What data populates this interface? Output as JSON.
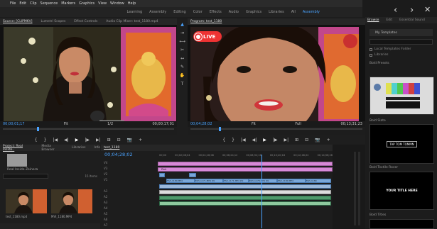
{
  "menu": [
    "File",
    "Edit",
    "Clip",
    "Sequence",
    "Markers",
    "Graphics",
    "View",
    "Window",
    "Help"
  ],
  "window_controls": [
    "—",
    "□",
    "✕"
  ],
  "workspaces": [
    "Learning",
    "Assembly",
    "Editing",
    "Color",
    "Effects",
    "Audio",
    "Graphics",
    "Libraries",
    "All",
    "Assembly"
  ],
  "workspace_active_index": 9,
  "source_monitor": {
    "tabs": [
      "Source: [CLIPMKV]",
      "Lumetri Scopes",
      "Effect Controls",
      "Audio Clip Mixer: test_1180.mp4"
    ],
    "timecode_left": "00;00;01;17",
    "fit": "Fit",
    "ratio": "1/2",
    "timecode_right": "00;00;17;01"
  },
  "program_monitor": {
    "tabs": [
      "Program: test_1180"
    ],
    "timecode_left": "00;04;28;02",
    "fit": "Fit",
    "ratio": "Full",
    "timecode_right": "00;13;31;23",
    "live_badge": "LIVE"
  },
  "transport": [
    "{",
    "}",
    "|◀",
    "◀|",
    "▶",
    "|▶",
    "▶|",
    "⊞",
    "⊟",
    "📷",
    "+"
  ],
  "right_panel": {
    "tabs": [
      "Browse",
      "Edit",
      "Essential Sound"
    ],
    "my_templates": "My Templates",
    "checkbox_1": "Local Templates Folder",
    "checkbox_2": "Libraries",
    "section_1": "Bold Presets",
    "section_2": "Bold Slate",
    "slate_text": "TAP TOM TOMMN",
    "section_3": "Bold Textile Rover",
    "title_text": "YOUR TITLE HERE",
    "section_4": "Bold Titles"
  },
  "project": {
    "tabs": [
      "Project: Real Inside..",
      "Media Browser",
      "Libraries",
      "Info"
    ],
    "bin": "Real Inside Zeinora",
    "search_placeholder": "",
    "items_count": "15 Items",
    "thumb_1_label": "test_1180.mp4",
    "thumb_2_label": "MVI_1180.MP4"
  },
  "timeline": {
    "tab": "test_1180",
    "timecode": "00;04;28;02",
    "ruler": [
      "00;00",
      "00;02;08;04",
      "00;04;16;08",
      "00;06;24;12",
      "00;08;32;16",
      "00;10;40;18",
      "00;12;48;22",
      "00;14;56;26"
    ],
    "tracks": [
      "V4",
      "V3",
      "V2",
      "V1",
      "A1",
      "A2",
      "A3",
      "A4",
      "A5",
      "A6",
      "A7",
      "A8"
    ],
    "pink_clip_label": "Pink",
    "v1_clips": [
      "MVI_1180.MP4",
      "MVI_1171.MP4 [V]",
      "MVI_1171.MP4 [V]",
      "MVI_1178.MP4 [V]",
      "MVI_1180.MP4",
      "MVI_1180"
    ]
  },
  "colors": {
    "accent_blue": "#4aa3ff",
    "pink": "#d88ad8",
    "video_blue": "#7aa7d8",
    "audio_green": "#4f9a6b",
    "live_red": "#e33"
  }
}
